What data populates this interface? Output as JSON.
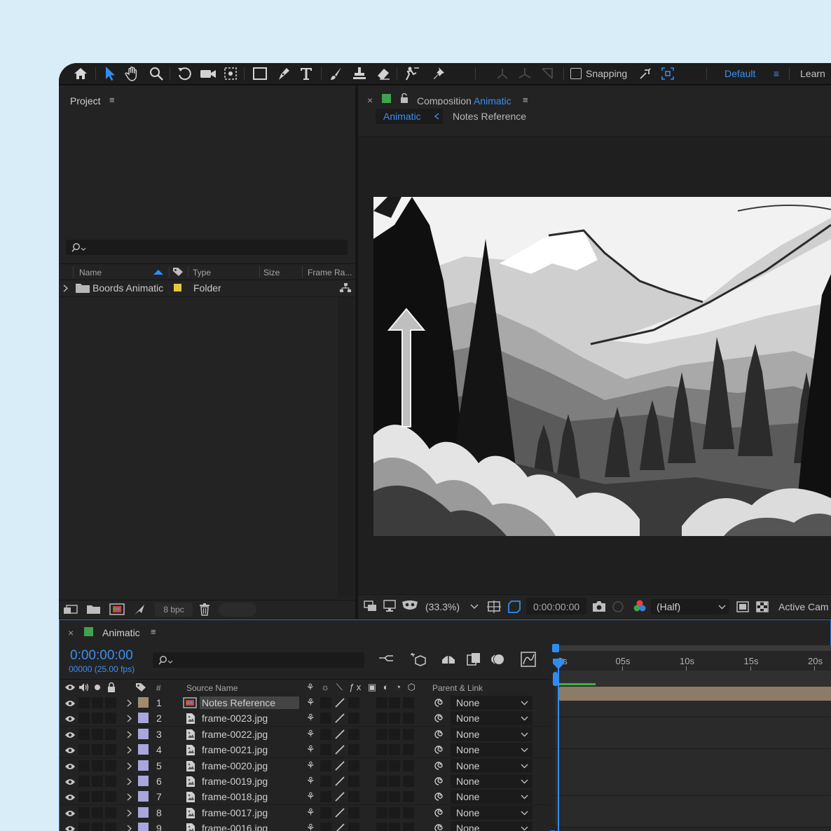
{
  "toolbar": {
    "snapping_label": "Snapping",
    "workspace_label": "Default",
    "learn_label": "Learn"
  },
  "project": {
    "title": "Project",
    "columns": [
      "Name",
      "Type",
      "Size",
      "Frame Ra..."
    ],
    "items": [
      {
        "name": "Boords Animatic",
        "type": "Folder",
        "label_color": "#e6c83a"
      }
    ],
    "bpc_label": "8 bpc"
  },
  "composition": {
    "title_prefix": "Composition",
    "title_name": "Animatic",
    "tabs": [
      "Animatic",
      "Notes Reference"
    ],
    "zoom": "(33.3%)",
    "timecode": "0:00:00:00",
    "resolution": "(Half)",
    "camera": "Active Cam"
  },
  "timeline": {
    "comp_name": "Animatic",
    "current_time": "0:00:00:00",
    "frame_info": "00000 (25.00 fps)",
    "col_source": "Source Name",
    "col_number": "#",
    "col_parent": "Parent & Link",
    "ruler": [
      "0s",
      "05s",
      "10s",
      "15s",
      "20s"
    ],
    "layers": [
      {
        "num": "1",
        "name": "Notes Reference",
        "parent": "None",
        "label_color": "#a08b6f",
        "selected": true
      },
      {
        "num": "2",
        "name": "frame-0023.jpg",
        "parent": "None",
        "label_color": "#a9a6dc"
      },
      {
        "num": "3",
        "name": "frame-0022.jpg",
        "parent": "None",
        "label_color": "#a9a6dc"
      },
      {
        "num": "4",
        "name": "frame-0021.jpg",
        "parent": "None",
        "label_color": "#a9a6dc"
      },
      {
        "num": "5",
        "name": "frame-0020.jpg",
        "parent": "None",
        "label_color": "#a9a6dc"
      },
      {
        "num": "6",
        "name": "frame-0019.jpg",
        "parent": "None",
        "label_color": "#a9a6dc"
      },
      {
        "num": "7",
        "name": "frame-0018.jpg",
        "parent": "None",
        "label_color": "#a9a6dc"
      },
      {
        "num": "8",
        "name": "frame-0017.jpg",
        "parent": "None",
        "label_color": "#a9a6dc"
      },
      {
        "num": "9",
        "name": "frame-0016.jpg",
        "parent": "None",
        "label_color": "#a9a6dc"
      }
    ]
  },
  "colors": {
    "accent": "#2d8ceb",
    "comp_label": "#3fa34d",
    "background": "#d9edf8"
  }
}
